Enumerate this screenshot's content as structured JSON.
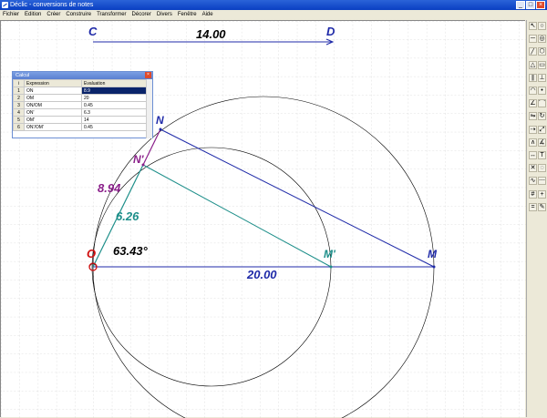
{
  "window": {
    "title": "Déclic - conversions de notes",
    "buttons": {
      "minimize": "_",
      "maximize": "□",
      "close": "×"
    }
  },
  "menu": [
    "Fichier",
    "Edition",
    "Créer",
    "Construire",
    "Transformer",
    "Décorer",
    "Divers",
    "Fenêtre",
    "Aide"
  ],
  "calc": {
    "title": "Calcul",
    "headers": {
      "index": "i",
      "expression": "Expression",
      "evaluation": "Evaluation"
    },
    "rows": [
      {
        "i": "1",
        "expr": "ON",
        "val": "8.9"
      },
      {
        "i": "2",
        "expr": "OM",
        "val": "20"
      },
      {
        "i": "3",
        "expr": "ON/OM",
        "val": "0.45"
      },
      {
        "i": "4",
        "expr": "ON'",
        "val": "6.3"
      },
      {
        "i": "5",
        "expr": "OM'",
        "val": "14"
      },
      {
        "i": "6",
        "expr": "ON'/OM'",
        "val": "0.45"
      }
    ]
  },
  "figure": {
    "points": {
      "C": "C",
      "D": "D",
      "O": "O",
      "N": "N",
      "N_prime": "N'",
      "M": "M",
      "M_prime": "M'"
    },
    "measures": {
      "CD": "14.00",
      "OM": "20.00",
      "ON": "8.94",
      "ON_prime": "6.26",
      "angle": "63.43°"
    },
    "colors": {
      "grid": "#c0c0c0",
      "blue": "#1f2aa8",
      "teal": "#1e8f8a",
      "purple": "#8a1f8a",
      "red": "#d01010",
      "black": "#000000"
    }
  },
  "toolbar_icons": [
    "pointer-icon",
    "circle-icon",
    "segment-icon",
    "circle-3pt-icon",
    "line-icon",
    "polygon-icon",
    "triangle-icon",
    "rectangle-icon",
    "parallel-icon",
    "perpendicular-icon",
    "arc-icon",
    "midpoint-icon",
    "bisector-icon",
    "tangent-icon",
    "symmetry-icon",
    "rotation-icon",
    "translation-icon",
    "homothety-icon",
    "compass-icon",
    "angle-icon",
    "measure-icon",
    "text-icon",
    "erase-icon",
    "hide-icon",
    "locus-icon",
    "trace-icon",
    "grid-icon",
    "axes-icon",
    "calc-icon",
    "pencil-icon"
  ]
}
